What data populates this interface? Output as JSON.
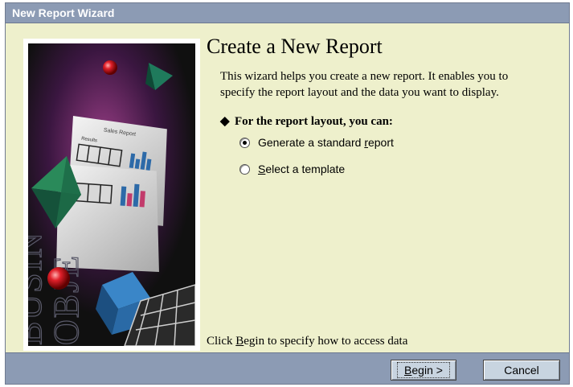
{
  "window": {
    "title": "New Report Wizard"
  },
  "heading": "Create a New Report",
  "intro": "This wizard helps you create a new report. It enables you to specify the report layout and the data you want to display.",
  "layout_section": {
    "label": "For the report layout, you can:",
    "options": [
      {
        "pre": "Generate a standard ",
        "accel": "r",
        "post": "eport",
        "selected": true
      },
      {
        "pre": "",
        "accel": "S",
        "post": "elect a template",
        "selected": false
      }
    ]
  },
  "footer_hint": {
    "pre": "Click ",
    "accel": "B",
    "post": "egin to specify how to access data"
  },
  "buttons": {
    "begin": {
      "accel": "B",
      "post": "egin >"
    },
    "cancel": "Cancel"
  },
  "art": {
    "mock_report_title": "Sales Report",
    "mock_report_sub": "Results",
    "brand_vertical_1": "BUSIN",
    "brand_vertical_2": "OBJE"
  },
  "colors": {
    "titlebar": "#8c9bb4",
    "panel": "#eef0cc",
    "button": "#c8d4e0"
  }
}
